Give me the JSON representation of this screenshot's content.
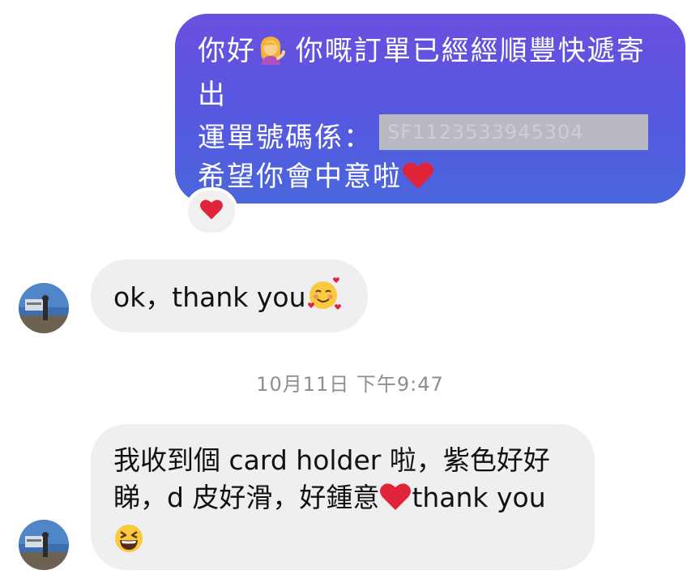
{
  "messages": [
    {
      "direction": "outgoing",
      "lines": [
        {
          "before_emoji": "你好",
          "emoji_icon": "woman-tipping-hand-emoji",
          "after_emoji": " 你嘅訂單已經經順豐快遞寄"
        },
        {
          "text": "出"
        },
        {
          "label": "運單號碼係：",
          "redacted_value": "SF1123533945304"
        },
        {
          "text": "希望你會中意啦",
          "emoji_icon": "red-heart-emoji"
        }
      ],
      "reaction": {
        "icon": "red-heart-emoji"
      }
    },
    {
      "direction": "incoming",
      "text": "ok，thank you",
      "emoji_icon": "smiling-face-with-hearts-emoji"
    },
    {
      "direction": "incoming",
      "lines": [
        {
          "text": "我收到個 card holder 啦，紫色好好"
        },
        {
          "before_emoji": "睇，d 皮好滑，好鍾意",
          "emoji_icon": "red-heart-emoji",
          "after_emoji": "thank you"
        },
        {
          "emoji_icon": "grinning-squinting-face-emoji"
        }
      ]
    }
  ],
  "timestamp": "10月11日 下午9:47",
  "colors": {
    "outgoing_bubble_top": "#6a4fe0",
    "outgoing_bubble_bottom": "#4a66dc",
    "incoming_bubble": "#efeff1",
    "timestamp_text": "#8e8e93",
    "heart": "#e0243a"
  }
}
